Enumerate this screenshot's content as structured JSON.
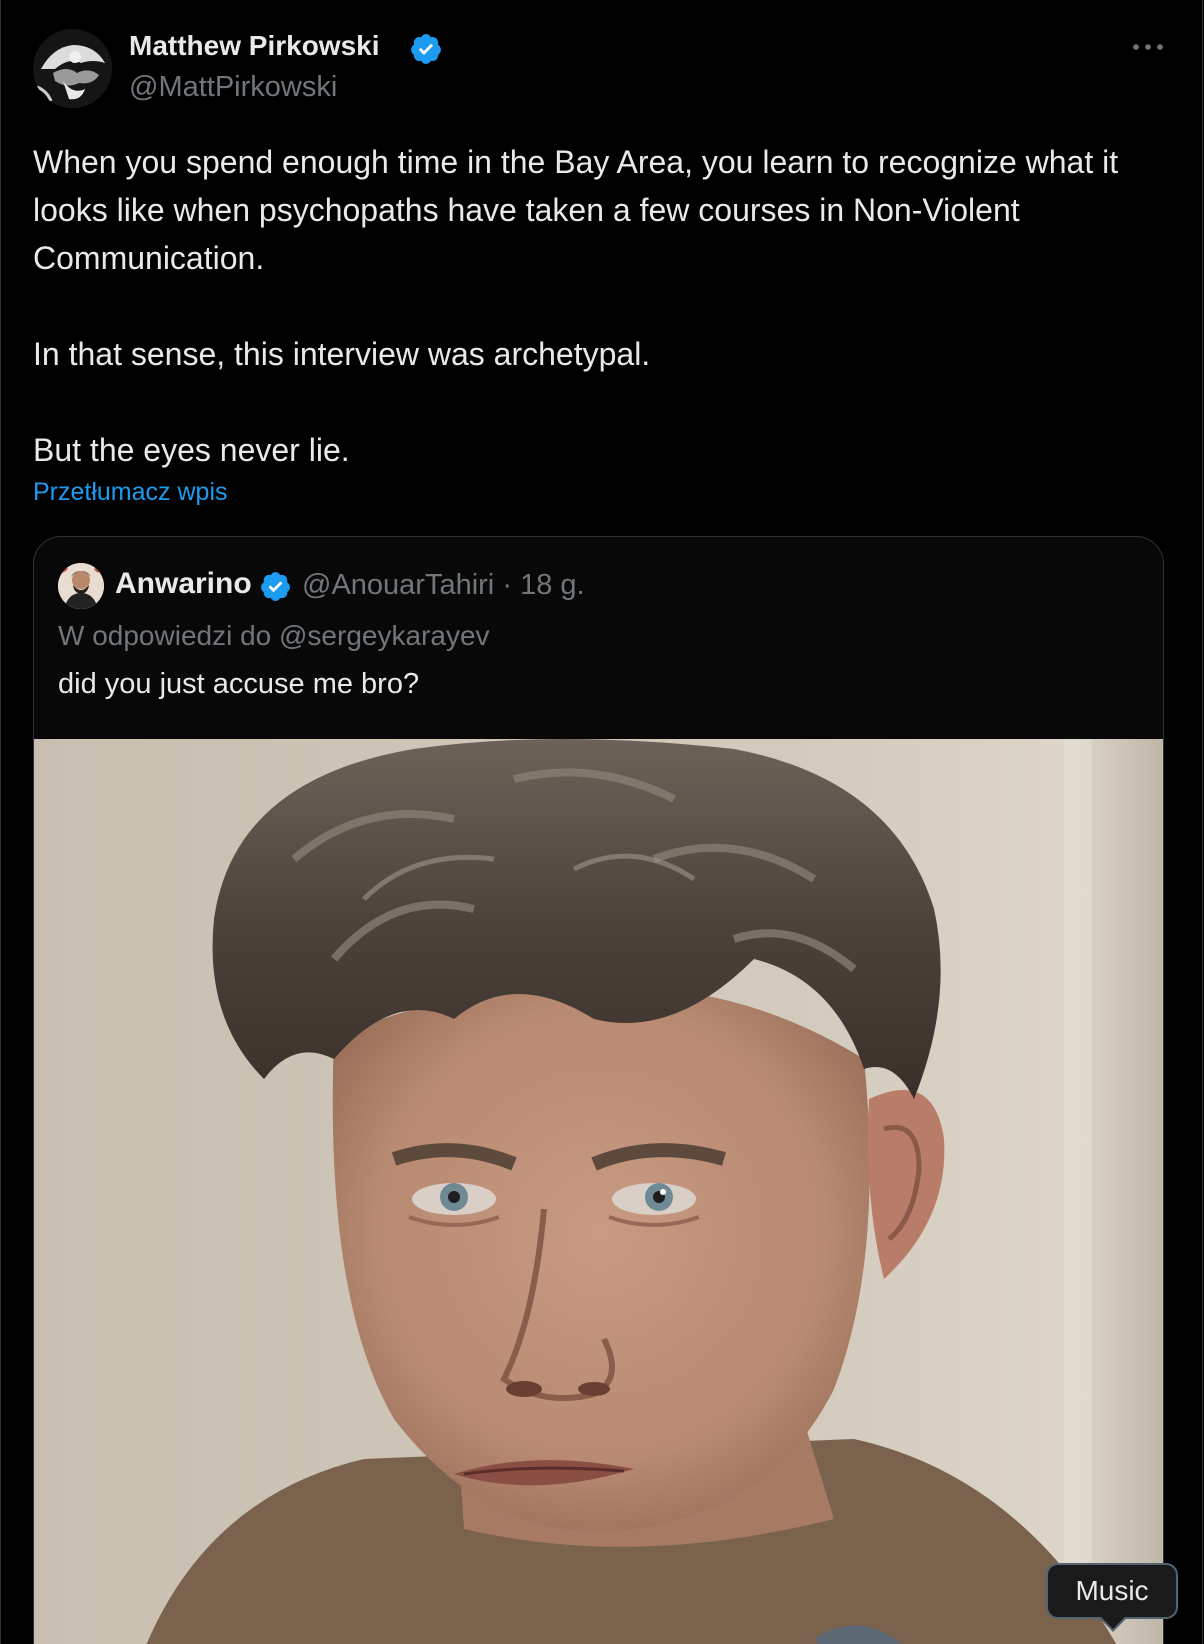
{
  "author": {
    "display_name": "Matthew Pirkowski",
    "handle": "@MattPirkowski",
    "verified": true,
    "verified_color": "#1d9bf0"
  },
  "tweet": {
    "lines": [
      "When you spend enough time in the Bay Area, you learn to recognize what it looks like when psychopaths have taken a few courses in Non-Violent Communication.",
      "In that sense, this interview was archetypal.",
      "But the eyes never lie."
    ],
    "translate_label": "Przetłumacz wpis"
  },
  "quoted": {
    "display_name": "Anwarino",
    "handle": "@AnouarTahiri",
    "separator": "·",
    "time": "18 g.",
    "reply_to": "W odpowiedzi do @sergeykarayev",
    "text": "did you just accuse me bro?",
    "media_tooltip": "Music"
  },
  "icons": {
    "more": "more-horizontal-icon",
    "verified": "verified-badge-icon"
  },
  "colors": {
    "background": "#000000",
    "text": "#e7e9ea",
    "secondary_text": "#71767b",
    "link": "#1d9bf0",
    "border": "#2f3336"
  }
}
